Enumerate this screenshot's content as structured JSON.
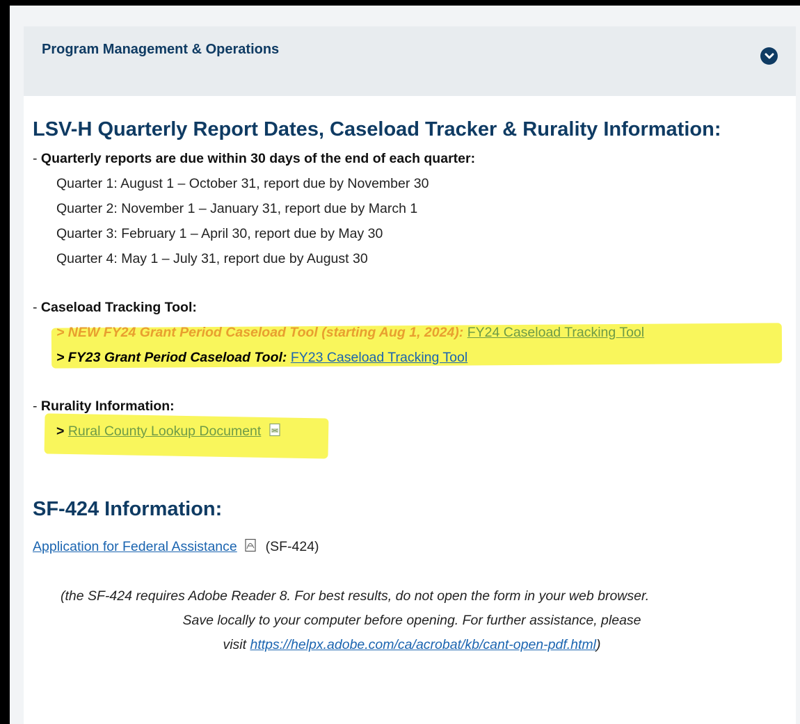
{
  "accordion": {
    "title": "Program Management & Operations"
  },
  "section1": {
    "heading": "LSV-H Quarterly Report Dates, Caseload Tracker & Rurality Information:",
    "quarterly_prefix": "- ",
    "quarterly_label": "Quarterly reports are due within 30 days of the end of each quarter:",
    "quarters": [
      "Quarter 1: August 1 – October 31, report due by November 30",
      "Quarter 2: November 1 – January 31, report due by March 1",
      "Quarter 3: February 1 – April 30, report due by May 30",
      "Quarter 4: May 1 – July 31, report due by August 30"
    ],
    "caseload_prefix": "- ",
    "caseload_label": "Caseload Tracking Tool:",
    "fy24_text": "> NEW FY24 Grant Period Caseload Tool (starting Aug 1, 2024):",
    "fy24_link": "FY24 Caseload Tracking Tool",
    "fy23_text": "> FY23 Grant Period Caseload Tool:",
    "fy23_link": "FY23 Caseload Tracking Tool",
    "rurality_prefix": "- ",
    "rurality_label": "Rurality Information:",
    "rural_arrow": "> ",
    "rural_link": "Rural County Lookup Document"
  },
  "section2": {
    "heading": "SF-424 Information:",
    "app_link": "Application for Federal Assistance",
    "app_suffix": "(SF-424)",
    "note_line1": "(the SF-424 requires Adobe Reader 8. For best results, do not open the form in your web browser.",
    "note_line2": "Save locally to your computer before opening. For further assistance, please",
    "note_line3_prefix": "visit ",
    "note_url": "https://helpx.adobe.com/ca/acrobat/kb/cant-open-pdf.html",
    "note_close": ")"
  },
  "colors": {
    "heading": "#0f3b63",
    "link": "#1a64b0",
    "highlight": "#f9f65c",
    "orange_text": "#e89f2f",
    "green_link": "#6e9b47",
    "header_bg": "#e8ecef"
  },
  "icons": [
    "chevron-down-icon",
    "pdf-icon"
  ]
}
